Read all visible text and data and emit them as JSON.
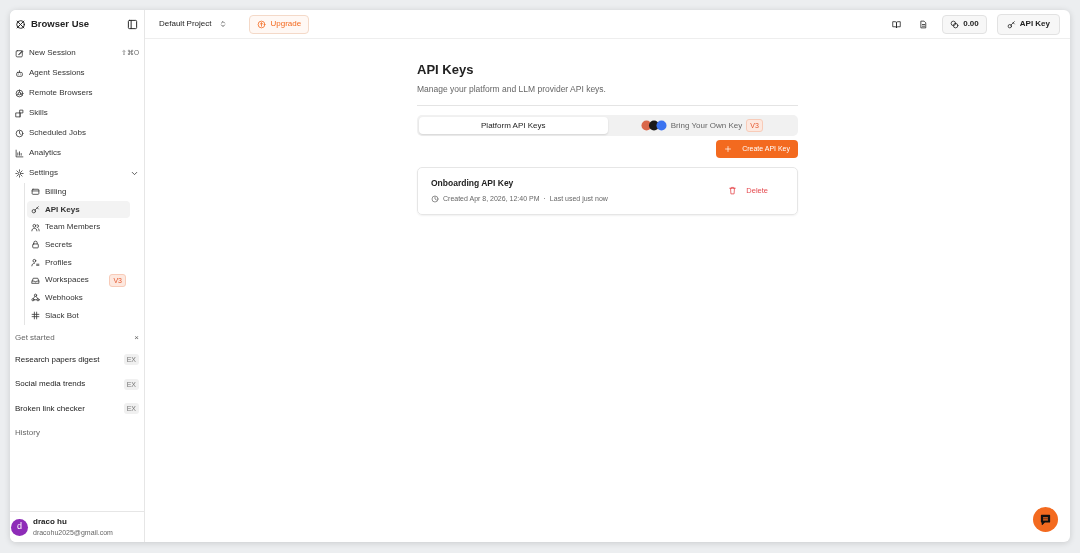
{
  "sidebar": {
    "brand": "Browser Use",
    "nav": [
      {
        "label": "New Session",
        "shortcut": "⇧⌘O"
      },
      {
        "label": "Agent Sessions"
      },
      {
        "label": "Remote Browsers"
      },
      {
        "label": "Skills"
      },
      {
        "label": "Scheduled Jobs"
      },
      {
        "label": "Analytics"
      }
    ],
    "settings": {
      "label": "Settings",
      "expanded": true,
      "children": [
        {
          "label": "Billing",
          "selected": false
        },
        {
          "label": "API Keys",
          "selected": true
        },
        {
          "label": "Team Members",
          "selected": false
        },
        {
          "label": "Secrets",
          "selected": false
        },
        {
          "label": "Profiles",
          "selected": false
        },
        {
          "label": "Workspaces",
          "selected": false,
          "badge": "V3"
        },
        {
          "label": "Webhooks",
          "selected": false
        },
        {
          "label": "Slack Bot",
          "selected": false
        }
      ]
    },
    "get_started": {
      "title": "Get started",
      "close": "×",
      "items": [
        {
          "label": "Research papers digest",
          "badge": "EX"
        },
        {
          "label": "Social media trends",
          "badge": "EX"
        },
        {
          "label": "Broken link checker",
          "badge": "EX"
        }
      ]
    },
    "history_title": "History",
    "user": {
      "avatar": "d",
      "name": "draco hu",
      "email": "dracohu2025@gmail.com"
    }
  },
  "header": {
    "project": "Default Project",
    "upgrade": "Upgrade",
    "credits": "0.00",
    "api_key_button": "API Key"
  },
  "page": {
    "title": "API Keys",
    "subtitle": "Manage your platform and LLM provider API keys.",
    "tabs": [
      {
        "label": "Platform API Keys",
        "selected": true
      },
      {
        "label": "Bring Your Own Key",
        "selected": false,
        "badge": "V3"
      }
    ],
    "create_button": "Create API Key",
    "keys": [
      {
        "name": "Onboarding API Key",
        "created": "Created Apr 8, 2026, 12:40 PM",
        "separator": "·",
        "last_used": "Last used just now",
        "delete": "Delete"
      }
    ]
  }
}
